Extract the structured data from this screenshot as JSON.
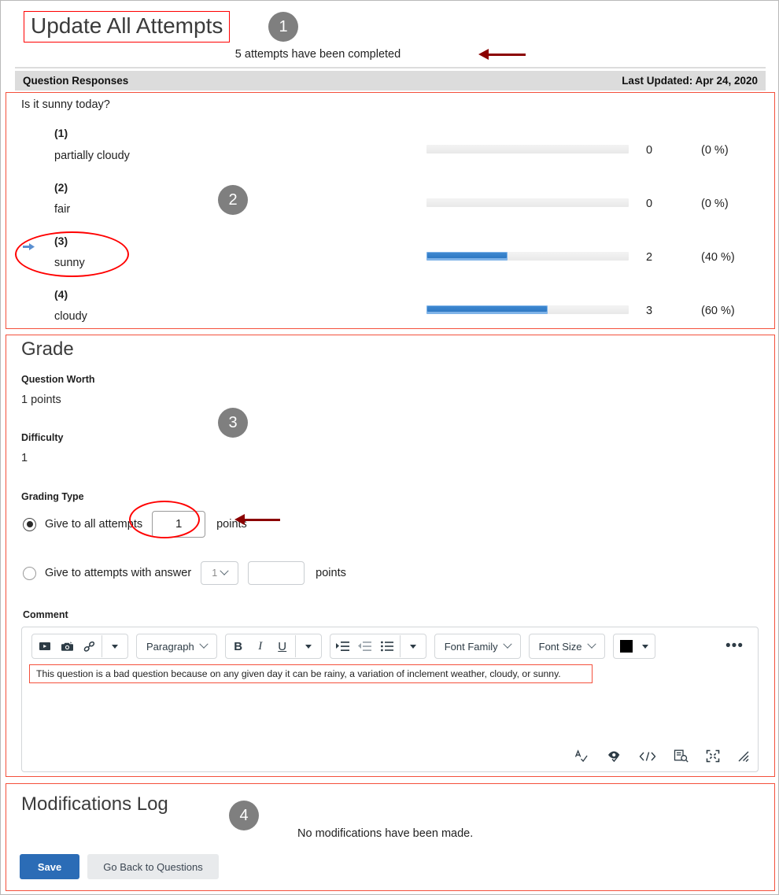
{
  "header": {
    "title": "Update All Attempts",
    "badge1": "1",
    "attempts_note": "5 attempts have been completed",
    "band_left": "Question Responses",
    "band_right": "Last Updated: Apr 24, 2020"
  },
  "responses": {
    "badge2": "2",
    "question": "Is it sunny today?",
    "options": [
      {
        "num": "(1)",
        "label": "partially cloudy",
        "count": "0",
        "percent": "(0 %)",
        "pct_value": 0,
        "selected": false
      },
      {
        "num": "(2)",
        "label": "fair",
        "count": "0",
        "percent": "(0 %)",
        "pct_value": 0,
        "selected": false
      },
      {
        "num": "(3)",
        "label": "sunny",
        "count": "2",
        "percent": "(40 %)",
        "pct_value": 40,
        "selected": true
      },
      {
        "num": "(4)",
        "label": "cloudy",
        "count": "3",
        "percent": "(60 %)",
        "pct_value": 60,
        "selected": false
      }
    ]
  },
  "grade": {
    "badge3": "3",
    "heading": "Grade",
    "question_worth_label": "Question Worth",
    "question_worth_value": "1 points",
    "difficulty_label": "Difficulty",
    "difficulty_value": "1",
    "grading_type_label": "Grading Type",
    "option_all_label": "Give to all attempts",
    "option_all_points_value": "1",
    "option_all_points_word": "points",
    "option_answer_label": "Give to attempts with answer",
    "option_answer_select_value": "1",
    "option_answer_points_value": "",
    "option_answer_points_word": "points",
    "comment_label": "Comment",
    "comment_text": "This question is a bad question because on any given day it can be rainy, a variation of inclement weather, cloudy, or sunny."
  },
  "editor": {
    "paragraph_label": "Paragraph",
    "font_family_label": "Font Family",
    "font_size_label": "Font Size",
    "more_label": "•••"
  },
  "modifications": {
    "badge4": "4",
    "heading": "Modifications Log",
    "empty_text": "No modifications have been made.",
    "save_label": "Save",
    "back_label": "Go Back to Questions"
  },
  "colors": {
    "annotation_red": "#ff0000",
    "panel_red": "#f4503c",
    "arrow_dark_red": "#8b0000",
    "badge_gray": "#7f7f7f",
    "bar_blue": "#3e88d0",
    "save_blue": "#2b6cb6"
  }
}
